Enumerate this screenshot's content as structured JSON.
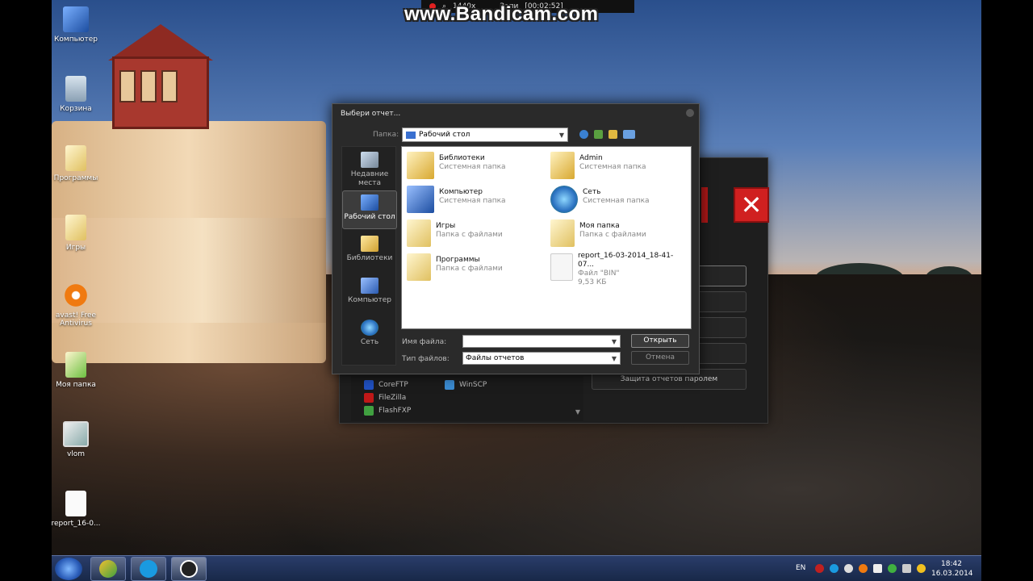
{
  "desktop": {
    "icons": [
      {
        "label": "Компьютер"
      },
      {
        "label": "Корзина"
      },
      {
        "label": "Программы"
      },
      {
        "label": "Игры"
      },
      {
        "label": "avast! Free Antivirus"
      },
      {
        "label": "Моя папка"
      },
      {
        "label": "vlom"
      },
      {
        "label": "report_16-0..."
      }
    ]
  },
  "recorder": {
    "watermark": "www.Bandicam.com",
    "resolution": "1440x",
    "recording_label": "Запи",
    "timer": "[00:02:52]"
  },
  "back_window": {
    "buttons": [
      "ние",
      "",
      "",
      "",
      "Защита отчетов паролем"
    ],
    "ftp_clients": [
      "CoreFTP",
      "FileZilla",
      "FlashFXP",
      "WinSCP"
    ]
  },
  "dialog": {
    "title": "Выбери отчет...",
    "folder_label": "Папка:",
    "folder_value": "Рабочий стол",
    "places": [
      {
        "label": "Недавние места",
        "selected": false
      },
      {
        "label": "Рабочий стол",
        "selected": true
      },
      {
        "label": "Библиотеки",
        "selected": false
      },
      {
        "label": "Компьютер",
        "selected": false
      },
      {
        "label": "Сеть",
        "selected": false
      }
    ],
    "files": [
      {
        "name": "Библиотеки",
        "type": "Системная папка"
      },
      {
        "name": "Admin",
        "type": "Системная папка"
      },
      {
        "name": "Компьютер",
        "type": "Системная папка"
      },
      {
        "name": "Сеть",
        "type": "Системная папка"
      },
      {
        "name": "Игры",
        "type": "Папка с файлами"
      },
      {
        "name": "Моя папка",
        "type": "Папка с файлами"
      },
      {
        "name": "Программы",
        "type": "Папка с файлами"
      },
      {
        "name": "report_16-03-2014_18-41-07...",
        "type": "Файл \"BIN\"",
        "size": "9,53 КБ"
      }
    ],
    "filename_label": "Имя файла:",
    "filename_value": "",
    "filetype_label": "Тип файлов:",
    "filetype_value": "Файлы отчетов",
    "open_button": "Открыть",
    "cancel_button": "Отмена"
  },
  "taskbar": {
    "language": "EN",
    "time": "18:42",
    "date": "16.03.2014"
  },
  "colors": {
    "taskbar": "#182848",
    "dialog_bg": "#2a2a2a",
    "close_red": "#d02020"
  }
}
